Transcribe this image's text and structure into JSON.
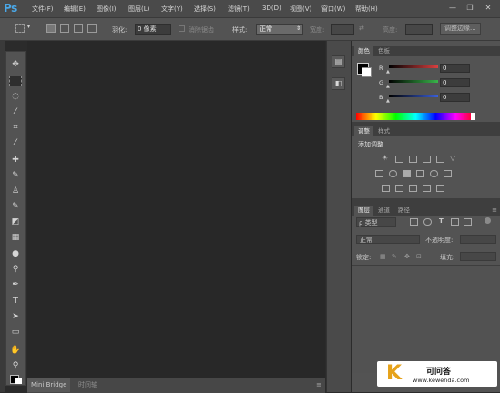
{
  "app": {
    "logo_text": "Ps"
  },
  "menu": {
    "items": [
      "文件(F)",
      "编辑(E)",
      "图像(I)",
      "图层(L)",
      "文字(Y)",
      "选择(S)",
      "滤镜(T)",
      "3D(D)",
      "视图(V)",
      "窗口(W)",
      "帮助(H)"
    ]
  },
  "window_controls": {
    "minimize": "—",
    "restore": "❐",
    "close": "✕"
  },
  "options_bar": {
    "feather_label": "羽化:",
    "feather_value": "0 像素",
    "antialias_label": "消除锯齿",
    "style_label": "样式:",
    "style_value": "正常",
    "width_label": "宽度:",
    "height_label": "高度:",
    "refine_edge_button": "调整边缘..."
  },
  "document_area": {
    "tabs": [
      "Mini Bridge",
      "时间轴"
    ]
  },
  "color_panel": {
    "tabs": [
      "颜色",
      "色板"
    ],
    "channels": [
      {
        "label": "R",
        "value": "0",
        "color": "#d94040"
      },
      {
        "label": "G",
        "value": "0",
        "color": "#39b54a"
      },
      {
        "label": "B",
        "value": "0",
        "color": "#3a5fd9"
      }
    ],
    "foreground": "#000000",
    "background": "#ffffff"
  },
  "adjustments_panel": {
    "tabs": [
      "调整",
      "样式"
    ],
    "heading": "添加调整"
  },
  "layers_panel": {
    "tabs": [
      "图层",
      "通道",
      "路径"
    ],
    "filter_kind": "ρ 类型",
    "blend_mode": "正常",
    "opacity_label": "不透明度:",
    "lock_label": "锁定:",
    "fill_label": "填充:"
  },
  "watermark": {
    "logo_letter": "K",
    "title": "可问答",
    "url": "www.kewenda.com"
  },
  "icons": {
    "move": "move-icon",
    "marquee": "rect-marquee-icon",
    "lasso": "lasso-icon",
    "quick_select": "quick-select-icon",
    "crop": "crop-icon",
    "eyedropper": "eyedropper-icon",
    "healing": "healing-brush-icon",
    "brush": "brush-icon",
    "stamp": "clone-stamp-icon",
    "history_brush": "history-brush-icon",
    "eraser": "eraser-icon",
    "gradient": "gradient-icon",
    "blur": "blur-icon",
    "dodge": "dodge-icon",
    "pen": "pen-icon",
    "type": "type-icon",
    "path_select": "path-select-icon",
    "shape": "rectangle-shape-icon",
    "hand": "hand-icon",
    "zoom": "zoom-icon"
  }
}
